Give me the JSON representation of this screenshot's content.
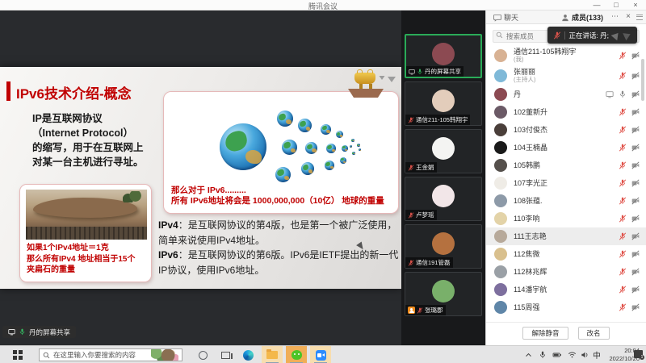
{
  "window": {
    "title": "腾讯会议",
    "minimize": "—",
    "maximize": "□",
    "close": "×"
  },
  "slide": {
    "title": "IPv6技术介绍-概念",
    "intro": "IP是互联网协议\n（Internet Protocol）\n的缩写，用于在互联网上\n对某一台主机进行寻址。",
    "rock_caption": "如果1个IPv4地址＝1克\n那么所有IPv4 地址相当于15个\n夹扁石的重量",
    "globe_caption": "那么对于 IPv6.........\n所有 IPv6地址将会是 1000,000,000（10亿） 地球的重量",
    "ipv4_label": "IPv4",
    "ipv4_text": "：是互联网协议的第4版，也是第一个被广泛使用，简单来说使用IPv4地址。",
    "ipv6_label": "IPv6",
    "ipv6_text": "：是互联网协议的第6版。IPv6是IETF提出的新一代IP协议，使用IPv6地址。"
  },
  "share": {
    "indicator_label": "丹的屏幕共享"
  },
  "video_tiles": [
    {
      "name": "丹的屏幕共享",
      "avatar": "#8c4a52",
      "active": true,
      "sharing": true,
      "mic": "on"
    },
    {
      "name": "通信211-105韩翔宇",
      "avatar": "#e3cdbb",
      "mic": "off"
    },
    {
      "name": "王金娟",
      "avatar": "#f4f4f2",
      "mic": "off"
    },
    {
      "name": "卢梦瑶",
      "avatar": "#f2e6e8",
      "mic": "off"
    },
    {
      "name": "通信191管磊",
      "avatar": "#b5713f",
      "mic": "off"
    },
    {
      "name": "张璐郡",
      "avatar": "#79b06a",
      "mic": "off",
      "badge": true
    }
  ],
  "panel": {
    "tab_chat": "聊天",
    "tab_members": "成员(133)",
    "more": "⋯",
    "close": "×",
    "search_placeholder": "搜索成员",
    "toast_text": "正在讲话: 丹;",
    "members": [
      {
        "name": "通信211-105韩翔宇",
        "sub": "(我)",
        "avatar": "#d8b294",
        "mic": "off",
        "cam": "off"
      },
      {
        "name": "张丽丽",
        "sub": "(主持人)",
        "avatar": "#7fb9d8",
        "mic": "off",
        "cam": "off"
      },
      {
        "name": "丹",
        "avatar": "#8c4a52",
        "mic": "on",
        "cam": "off",
        "sharing": true
      },
      {
        "name": "102董新升",
        "avatar": "#6b5a66",
        "mic": "off",
        "cam": "off"
      },
      {
        "name": "103付俊杰",
        "avatar": "#4a3f3a",
        "mic": "off",
        "cam": "off"
      },
      {
        "name": "104王楠晶",
        "avatar": "#1a1a1a",
        "mic": "off",
        "cam": "off"
      },
      {
        "name": "105韩鹏",
        "avatar": "#55504c",
        "mic": "off",
        "cam": "off"
      },
      {
        "name": "107李光正",
        "avatar": "#efece6",
        "mic": "off",
        "cam": "off"
      },
      {
        "name": "108张蕴.",
        "avatar": "#8d9aa8",
        "mic": "off",
        "cam": "off"
      },
      {
        "name": "110李响",
        "avatar": "#e3d3a8",
        "mic": "off",
        "cam": "off"
      },
      {
        "name": "111王志艳",
        "avatar": "#b7a99a",
        "mic": "off",
        "cam": "off",
        "highlight": true
      },
      {
        "name": "112焦微",
        "avatar": "#d9c08e",
        "mic": "off",
        "cam": "off"
      },
      {
        "name": "112林兆辉",
        "avatar": "#9aa0a6",
        "mic": "off",
        "cam": "off"
      },
      {
        "name": "114潘宇航",
        "avatar": "#7d6f9e",
        "mic": "off",
        "cam": "off"
      },
      {
        "name": "115周强",
        "avatar": "#5f86a8",
        "mic": "off",
        "cam": "off"
      }
    ],
    "unmute_button": "解除静音",
    "rename_button": "改名"
  },
  "taskbar": {
    "search_placeholder": "在这里输入你要搜索的内容",
    "ime": "中",
    "time": "20:04",
    "date": "2022/10/20",
    "notification_count": "1"
  },
  "colors": {
    "accent_red": "#c00000",
    "active_green": "#2aab58",
    "mute_red": "#e0544c"
  }
}
